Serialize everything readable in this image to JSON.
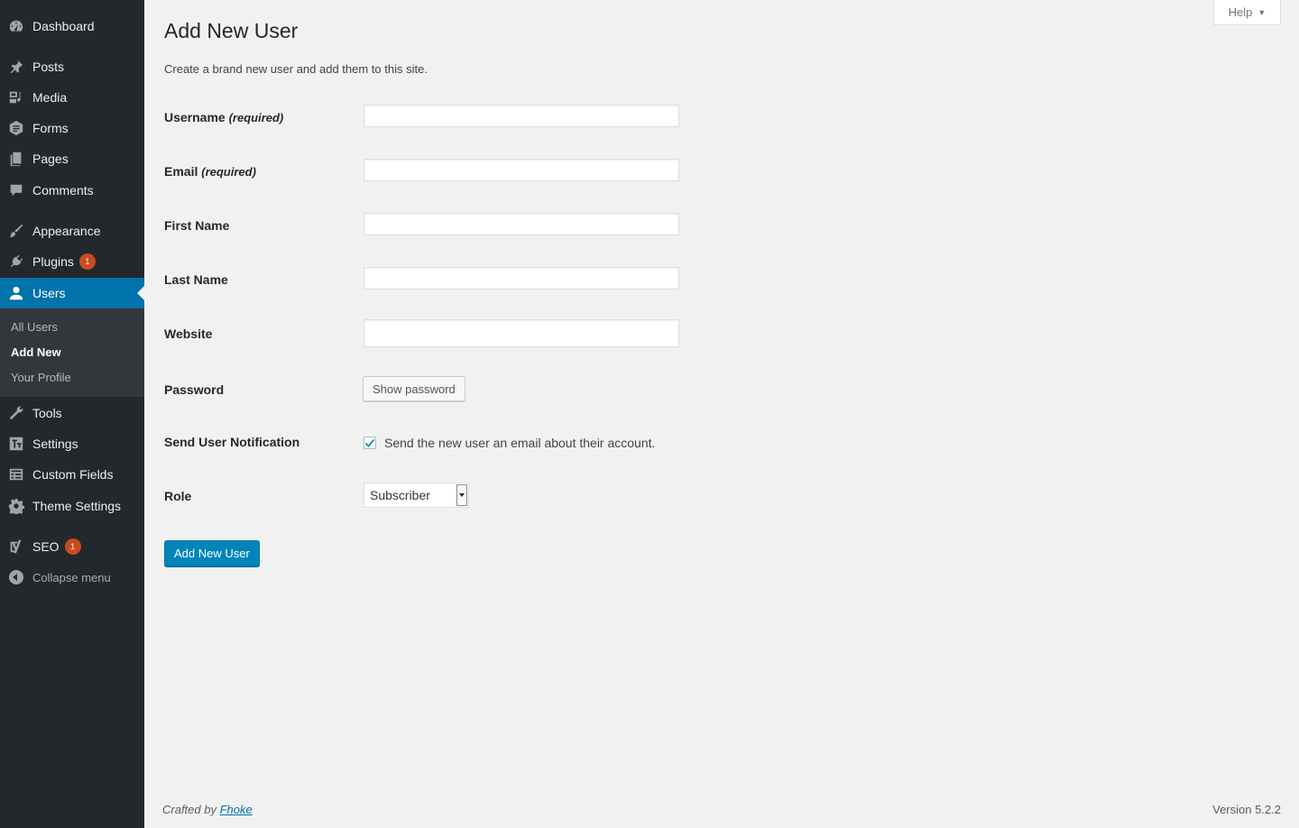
{
  "sidebar": {
    "items": [
      {
        "label": "Dashboard",
        "icon": "dashboard-icon"
      },
      {
        "label": "Posts",
        "icon": "pin-icon"
      },
      {
        "label": "Media",
        "icon": "media-icon"
      },
      {
        "label": "Forms",
        "icon": "forms-icon"
      },
      {
        "label": "Pages",
        "icon": "pages-icon"
      },
      {
        "label": "Comments",
        "icon": "comment-icon"
      },
      {
        "label": "Appearance",
        "icon": "brush-icon"
      },
      {
        "label": "Plugins",
        "icon": "plugin-icon",
        "badge": "1"
      },
      {
        "label": "Users",
        "icon": "user-icon",
        "active": true
      },
      {
        "label": "Tools",
        "icon": "wrench-icon"
      },
      {
        "label": "Settings",
        "icon": "settings-icon"
      },
      {
        "label": "Custom Fields",
        "icon": "table-icon"
      },
      {
        "label": "Theme Settings",
        "icon": "gear-icon"
      },
      {
        "label": "SEO",
        "icon": "yoast-icon",
        "badge": "1"
      }
    ],
    "submenu": [
      {
        "label": "All Users"
      },
      {
        "label": "Add New",
        "current": true
      },
      {
        "label": "Your Profile"
      }
    ],
    "collapse_label": "Collapse menu"
  },
  "help_tab": {
    "label": "Help"
  },
  "page": {
    "title": "Add New User",
    "description": "Create a brand new user and add them to this site."
  },
  "form": {
    "username": {
      "label": "Username",
      "required_note": "(required)",
      "value": ""
    },
    "email": {
      "label": "Email",
      "required_note": "(required)",
      "value": ""
    },
    "first_name": {
      "label": "First Name",
      "value": ""
    },
    "last_name": {
      "label": "Last Name",
      "value": ""
    },
    "website": {
      "label": "Website",
      "value": ""
    },
    "password": {
      "label": "Password",
      "button_label": "Show password"
    },
    "notification": {
      "label": "Send User Notification",
      "checkbox_text": "Send the new user an email about their account.",
      "checked": true
    },
    "role": {
      "label": "Role",
      "selected": "Subscriber"
    },
    "submit_label": "Add New User"
  },
  "footer": {
    "crafted_prefix": "Crafted by",
    "crafted_link": "Fhoke",
    "version": "Version 5.2.2"
  },
  "colors": {
    "sidebar_bg": "#23282d",
    "accent": "#0073aa",
    "button_primary": "#0085ba",
    "badge": "#ca4a1f"
  }
}
